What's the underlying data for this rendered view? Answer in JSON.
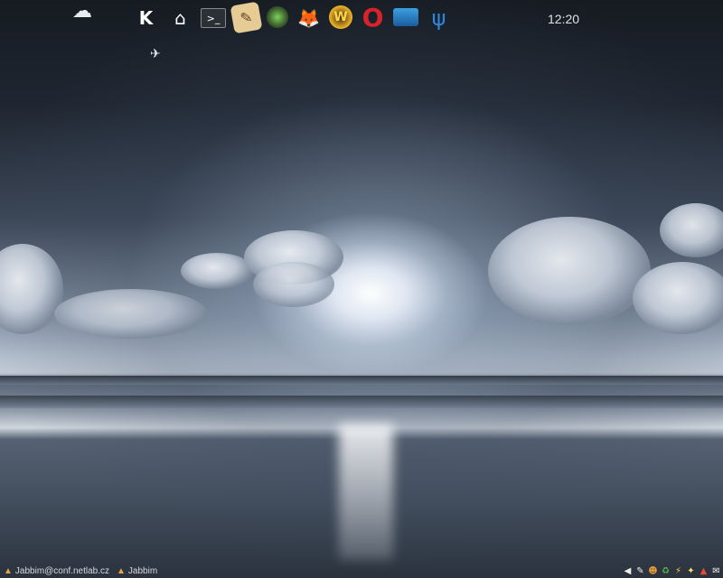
{
  "launcher": {
    "icons": [
      "kde-icon",
      "home-icon",
      "terminal-icon",
      "text-editor-icon",
      "media-player-icon",
      "gimp-icon",
      "world-of-warcraft-icon",
      "opera-icon",
      "file-manager-icon",
      "psi-icon"
    ]
  },
  "clock": {
    "time": "12:20"
  },
  "taskbar": {
    "tasks": [
      {
        "label": "Jabbim@conf.netlab.cz",
        "icon": "jabbim-icon"
      },
      {
        "label": "Jabbim",
        "icon": "jabbim-icon"
      }
    ]
  },
  "tray": {
    "icons": [
      "volume-icon",
      "network-icon",
      "chat-icon",
      "update-icon",
      "power-icon",
      "bulb-icon",
      "warning-icon",
      "mail-icon"
    ]
  },
  "colors": {
    "sky_top": "#161b22",
    "sun": "#ffffff",
    "text": "#dfe4ea"
  }
}
